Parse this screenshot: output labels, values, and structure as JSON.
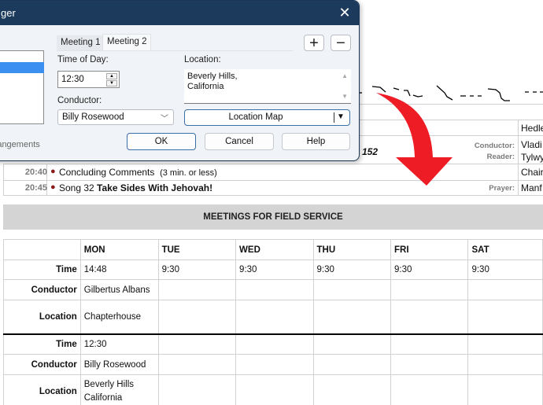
{
  "dialog": {
    "title": "ger",
    "close_icon": "close-icon",
    "tabs": [
      {
        "label": "Meeting 1",
        "active": false
      },
      {
        "label": "Meeting 2",
        "active": true
      }
    ],
    "add_icon": "+",
    "remove_icon": "−",
    "time_label": "Time of Day:",
    "time_value": "12:30",
    "conductor_label": "Conductor:",
    "conductor_value": "Billy Rosewood",
    "location_label": "Location:",
    "location_value": "Beverly Hills,\nCalifornia",
    "location_map_label": "Location Map",
    "arrangements_label": "rrangements",
    "ok_label": "OK",
    "cancel_label": "Cancel",
    "help_label": "Help"
  },
  "program": {
    "partial_number": "152",
    "rows": [
      {
        "time": "20:40",
        "text": "Concluding Comments",
        "note": "(3 min. or less)"
      },
      {
        "time": "20:45",
        "text_prefix": "Song 32 ",
        "text_bold": "Take Sides With Jehovah!"
      }
    ],
    "roles": {
      "row1_name": "Hedle",
      "conductor_label": "Conductor:",
      "conductor_name": "Vladi",
      "reader_label": "Reader:",
      "reader_name": "Tylwy",
      "chairman_name": "Chair",
      "prayer_label": "Prayer:",
      "prayer_name": "Manf"
    }
  },
  "field_service": {
    "title": "MEETINGS FOR FIELD SERVICE",
    "days": [
      "MON",
      "TUE",
      "WED",
      "THU",
      "FRI",
      "SAT"
    ],
    "meetings": [
      {
        "time_label": "Time",
        "times": [
          "14:48",
          "9:30",
          "9:30",
          "9:30",
          "9:30",
          "9:30"
        ],
        "conductor_label": "Conductor",
        "conductor": "Gilbertus Albans",
        "location_label": "Location",
        "location": "Chapterhouse"
      },
      {
        "time_label": "Time",
        "times": [
          "12:30",
          "",
          "",
          "",
          "",
          ""
        ],
        "conductor_label": "Conductor",
        "conductor": "Billy Rosewood",
        "location_label": "Location",
        "location_line1": "Beverly Hills",
        "location_line2": "California"
      }
    ]
  },
  "annotation": {
    "arrow_color": "#ee1c25"
  }
}
